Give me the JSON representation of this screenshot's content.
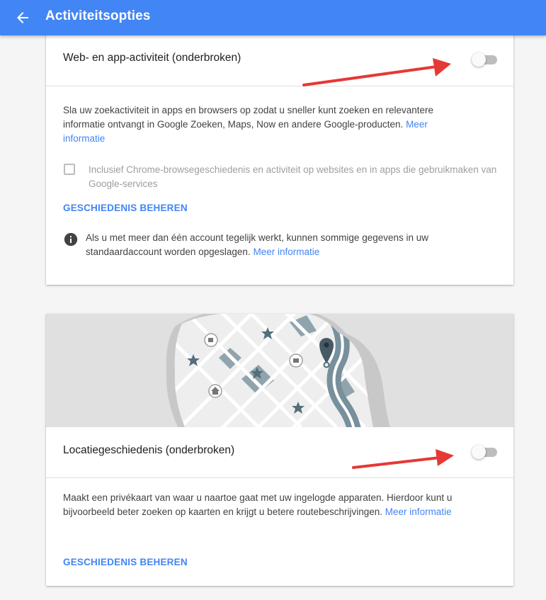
{
  "appbar": {
    "title": "Activiteitsopties",
    "back_icon": "arrow-back-icon",
    "color": "#4285f4"
  },
  "web_activity": {
    "title": "Web- en app-activiteit (onderbroken)",
    "toggle_on": false,
    "description": "Sla uw zoekactiviteit in apps en browsers op zodat u sneller kunt zoeken en relevantere informatie ontvangt in Google Zoeken, Maps, Now en andere Google-producten.",
    "more_info": "Meer informatie",
    "checkbox_label": "Inclusief Chrome-browsegeschiedenis en activiteit op websites en in apps die gebruikmaken van Google-services",
    "checkbox_checked": false,
    "manage_link": "GESCHIEDENIS BEHEREN",
    "info_icon": "info-icon",
    "info_text": "Als u met meer dan één account tegelijk werkt, kunnen sommige gegevens in uw standaardaccount worden opgeslagen.",
    "info_more": "Meer informatie"
  },
  "location_history": {
    "title": "Locatiegeschiedenis (onderbroken)",
    "toggle_on": false,
    "description": "Maakt een privékaart van waar u naartoe gaat met uw ingelogde apparaten. Hierdoor kunt u bijvoorbeeld beter zoeken op kaarten en krijgt u betere routebeschrijvingen.",
    "more_info": "Meer informatie",
    "manage_link": "GESCHIEDENIS BEHEREN",
    "illustration_icon": "map-illustration"
  },
  "colors": {
    "link": "#4285f4",
    "arrow": "#e53935"
  }
}
